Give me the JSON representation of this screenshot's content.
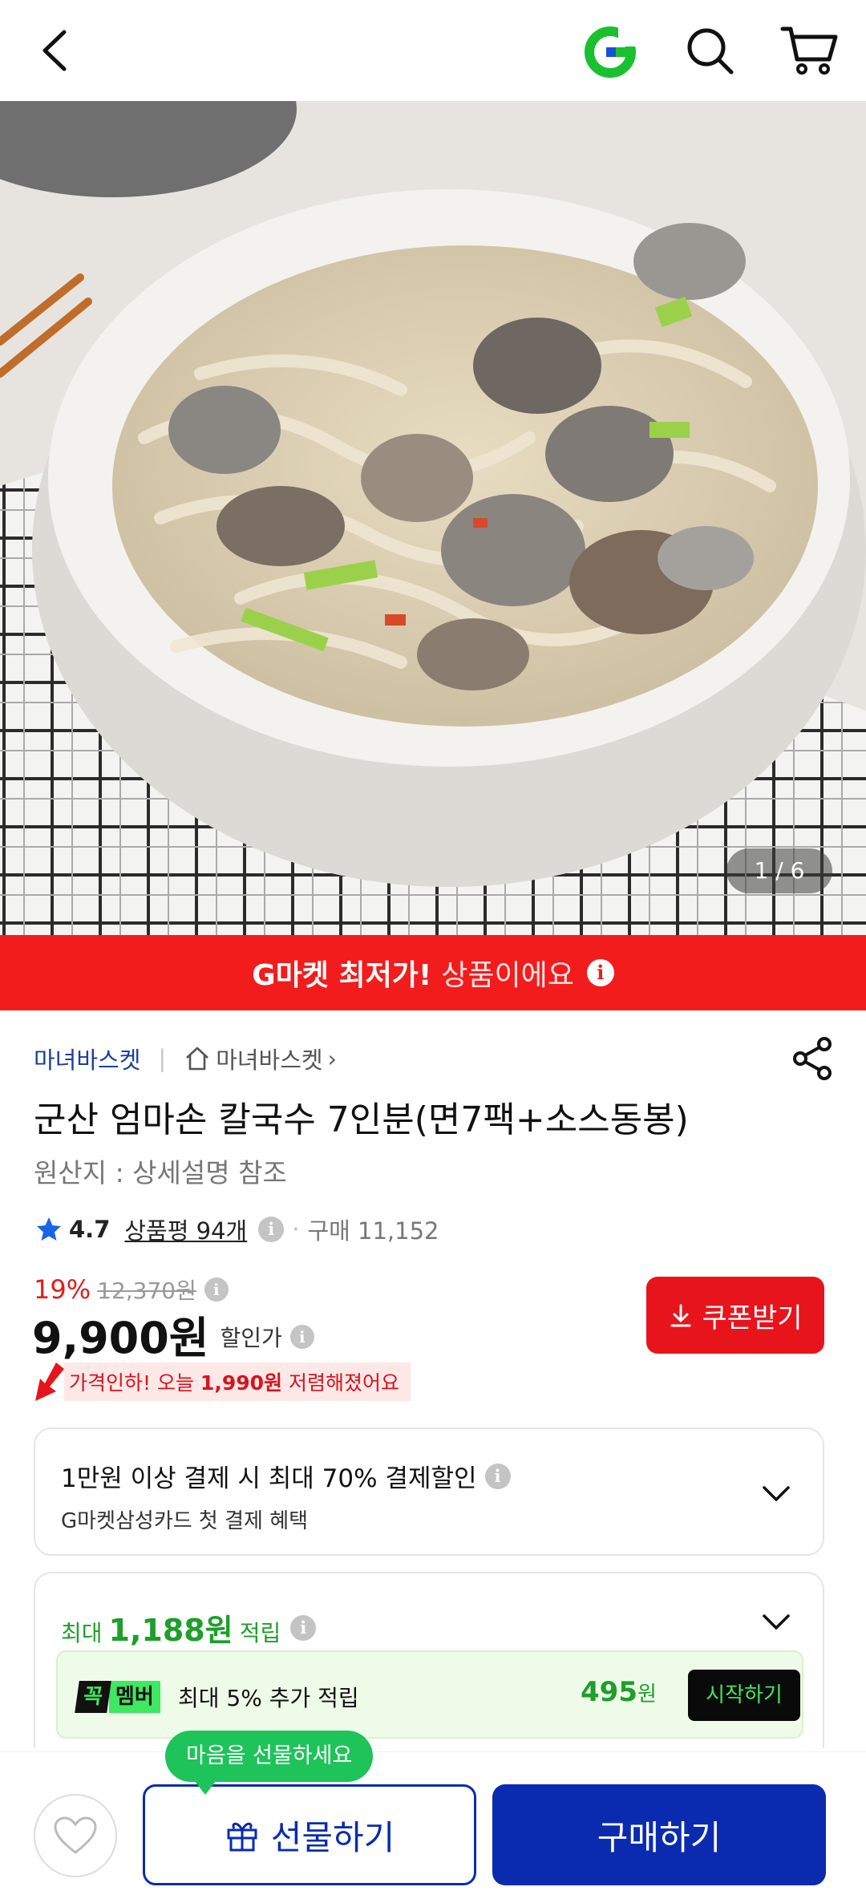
{
  "header": {
    "back_icon": "chevron-left-icon",
    "logo_icon": "gmarket-g-logo",
    "search_icon": "search-icon",
    "cart_icon": "cart-icon"
  },
  "hero": {
    "image": "bowl of clam kalguksu noodle soup",
    "counter": "1 / 6"
  },
  "banner": {
    "highlight": "G마켓 최저가!",
    "rest": "상품이에요",
    "info_icon": "i",
    "color": "#f21c1c"
  },
  "seller": {
    "name": "마녀바스켓",
    "divider": "|",
    "shop": "마녀바스켓",
    "chevron": "›"
  },
  "product": {
    "title": "군산 엄마손 칼국수 7인분(면7팩+소스동봉)",
    "origin": "원산지 : 상세설명 참조"
  },
  "rating": {
    "score": "4.7",
    "reviews": "상품평 94개",
    "info": "i",
    "dot": "·",
    "sales": "구매 11,152"
  },
  "price": {
    "discount": "19%",
    "original": "12,370원",
    "info1": "i",
    "current": "9,900원",
    "label": "할인가",
    "info2": "i"
  },
  "coupon": {
    "label": "쿠폰받기"
  },
  "price_cut": {
    "prefix": "가격인하! 오늘 ",
    "amount": "1,990원",
    "suffix": " 저렴해졌어요"
  },
  "payment_card": {
    "line1": "1만원 이상 결제 시 최대 70% 결제할인",
    "info": "i",
    "line2": "G마켓삼성카드 첫 결제 혜택"
  },
  "points_card": {
    "prefix": "최대",
    "amount": "1,188원",
    "suffix": "적립",
    "info": "i",
    "member": {
      "badge_k": "꼭",
      "badge_m": "멤버",
      "text": "최대 5% 추가 적립",
      "points": "495",
      "unit": "원",
      "button": "시작하기"
    }
  },
  "bottom": {
    "tooltip": "마음을 선물하세요",
    "gift_label": "선물하기",
    "buy_label": "구매하기",
    "brand_color": "#0a2bb0"
  }
}
